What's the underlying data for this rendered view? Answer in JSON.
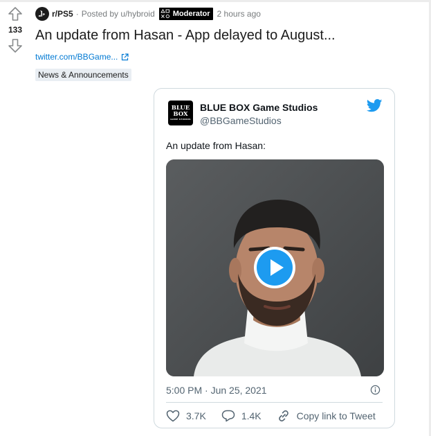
{
  "post": {
    "subreddit": "r/PS5",
    "separator": "·",
    "posted_by": "Posted by u/hybroid",
    "flair_badge": "Moderator",
    "time": "2 hours ago",
    "vote_count": "133",
    "title": "An update from Hasan - App delayed to August...",
    "link_text": "twitter.com/BBGame...",
    "flair": "News & Announcements"
  },
  "tweet": {
    "avatar_line1": "BLUE",
    "avatar_line2": "BOX",
    "avatar_line3": "GAME STUDIOS",
    "author_name": "BLUE BOX Game Studios",
    "author_handle": "@BBGameStudios",
    "text": "An update from Hasan:",
    "timestamp": "5:00 PM · Jun 25, 2021",
    "likes": "3.7K",
    "replies": "1.4K",
    "copy_link": "Copy link to Tweet"
  },
  "icons": {
    "upvote": "upvote-arrow-icon",
    "downvote": "downvote-arrow-icon",
    "external_link": "external-link-icon",
    "twitter": "twitter-bird-icon",
    "play": "play-icon",
    "info": "info-icon",
    "like": "heart-icon",
    "reply": "speech-bubble-icon",
    "copy_link": "link-icon"
  },
  "colors": {
    "link": "#0079d3",
    "twitter_blue": "#1d9bf0",
    "flair_bg": "#e9eef3"
  }
}
